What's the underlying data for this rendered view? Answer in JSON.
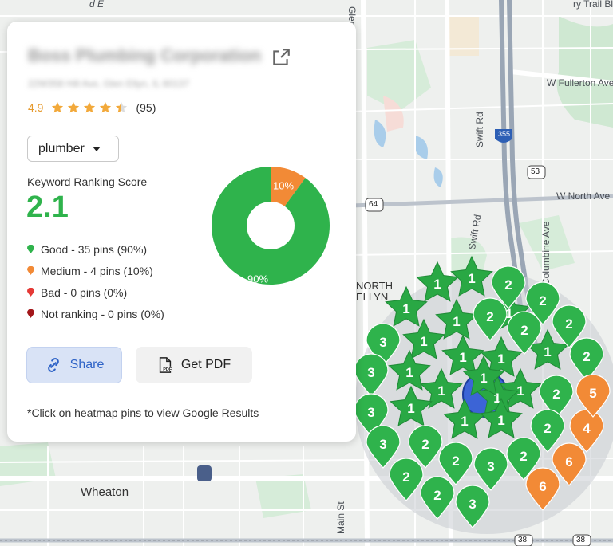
{
  "business": {
    "name": "Boss Plumbing Corporation",
    "address": "22W358 Hill Ave, Glen Ellyn, IL 60137",
    "rating": "4.9",
    "review_count": "(95)",
    "stars": 4.5
  },
  "keyword": {
    "selected": "plumber"
  },
  "score": {
    "label": "Keyword Ranking Score",
    "value": "2.1"
  },
  "legend": [
    {
      "label": "Good - 35 pins (90%)",
      "color": "#2fb34c"
    },
    {
      "label": "Medium - 4 pins (10%)",
      "color": "#f28a36"
    },
    {
      "label": "Bad - 0 pins (0%)",
      "color": "#e53935"
    },
    {
      "label": "Not ranking - 0 pins (0%)",
      "color": "#a3171a"
    }
  ],
  "chart_data": {
    "type": "pie",
    "categories": [
      "Good",
      "Medium"
    ],
    "values": [
      90,
      10
    ],
    "labels": [
      "90%",
      "10%"
    ],
    "colors": [
      "#2fb34c",
      "#f28a36"
    ]
  },
  "buttons": {
    "share": "Share",
    "pdf": "Get PDF"
  },
  "footnote": "*Click on heatmap pins to view Google Results",
  "map": {
    "labels": {
      "glen_ellyn_rd": "Glen Ellyn Rd",
      "swift_rd_top": "Swift Rd",
      "swift_rd_mid": "Swift Rd",
      "fullerton": "W Fullerton Ave",
      "north_ave": "W North Ave",
      "columbine": "Columbine Ave",
      "wheaton": "Wheaton",
      "main_st": "Main St",
      "north_ellyn": "NORTH ELLYN",
      "trail": "ry Trail Blv",
      "e_label": "d E",
      "shields": [
        "355",
        "53",
        "64",
        "38",
        "38"
      ]
    },
    "pins": [
      {
        "rank": "1",
        "shape": "star",
        "color": "#2fb34c"
      },
      {
        "rank": "1",
        "shape": "star",
        "color": "#2fb34c"
      },
      {
        "rank": "1",
        "shape": "star",
        "color": "#2fb34c"
      },
      {
        "rank": "1",
        "shape": "star",
        "color": "#2fb34c"
      },
      {
        "rank": "1",
        "shape": "star",
        "color": "#2fb34c"
      },
      {
        "rank": "1",
        "shape": "star",
        "color": "#2fb34c"
      },
      {
        "rank": "1",
        "shape": "star",
        "color": "#2fb34c"
      },
      {
        "rank": "1",
        "shape": "star",
        "color": "#2fb34c"
      },
      {
        "rank": "1",
        "shape": "star",
        "color": "#2fb34c"
      },
      {
        "rank": "1",
        "shape": "star",
        "color": "#2fb34c"
      },
      {
        "rank": "1",
        "shape": "star",
        "color": "#2fb34c"
      },
      {
        "rank": "1",
        "shape": "star",
        "color": "#2fb34c"
      },
      {
        "rank": "1",
        "shape": "star",
        "color": "#2fb34c"
      },
      {
        "rank": "1",
        "shape": "star",
        "color": "#2fb34c"
      },
      {
        "rank": "1",
        "shape": "star",
        "color": "#2fb34c"
      },
      {
        "rank": "1",
        "shape": "star",
        "color": "#2fb34c"
      },
      {
        "rank": "1",
        "shape": "star",
        "color": "#2fb34c"
      },
      {
        "rank": "2",
        "shape": "drop",
        "color": "#2fb34c"
      },
      {
        "rank": "2",
        "shape": "drop",
        "color": "#2fb34c"
      },
      {
        "rank": "2",
        "shape": "drop",
        "color": "#2fb34c"
      },
      {
        "rank": "2",
        "shape": "drop",
        "color": "#2fb34c"
      },
      {
        "rank": "2",
        "shape": "drop",
        "color": "#2fb34c"
      },
      {
        "rank": "2",
        "shape": "drop",
        "color": "#2fb34c"
      },
      {
        "rank": "2",
        "shape": "drop",
        "color": "#2fb34c"
      },
      {
        "rank": "2",
        "shape": "drop",
        "color": "#2fb34c"
      },
      {
        "rank": "2",
        "shape": "drop",
        "color": "#2fb34c"
      },
      {
        "rank": "2",
        "shape": "drop",
        "color": "#2fb34c"
      },
      {
        "rank": "2",
        "shape": "drop",
        "color": "#2fb34c"
      },
      {
        "rank": "2",
        "shape": "drop",
        "color": "#2fb34c"
      },
      {
        "rank": "2",
        "shape": "drop",
        "color": "#2fb34c"
      },
      {
        "rank": "3",
        "shape": "drop",
        "color": "#2fb34c"
      },
      {
        "rank": "3",
        "shape": "drop",
        "color": "#2fb34c"
      },
      {
        "rank": "3",
        "shape": "drop",
        "color": "#2fb34c"
      },
      {
        "rank": "3",
        "shape": "drop",
        "color": "#2fb34c"
      },
      {
        "rank": "3",
        "shape": "drop",
        "color": "#2fb34c"
      },
      {
        "rank": "3",
        "shape": "drop",
        "color": "#2fb34c"
      },
      {
        "rank": "4",
        "shape": "drop",
        "color": "#f28a36"
      },
      {
        "rank": "5",
        "shape": "drop",
        "color": "#f28a36"
      },
      {
        "rank": "6",
        "shape": "drop",
        "color": "#f28a36"
      },
      {
        "rank": "6",
        "shape": "drop",
        "color": "#f28a36"
      }
    ]
  }
}
